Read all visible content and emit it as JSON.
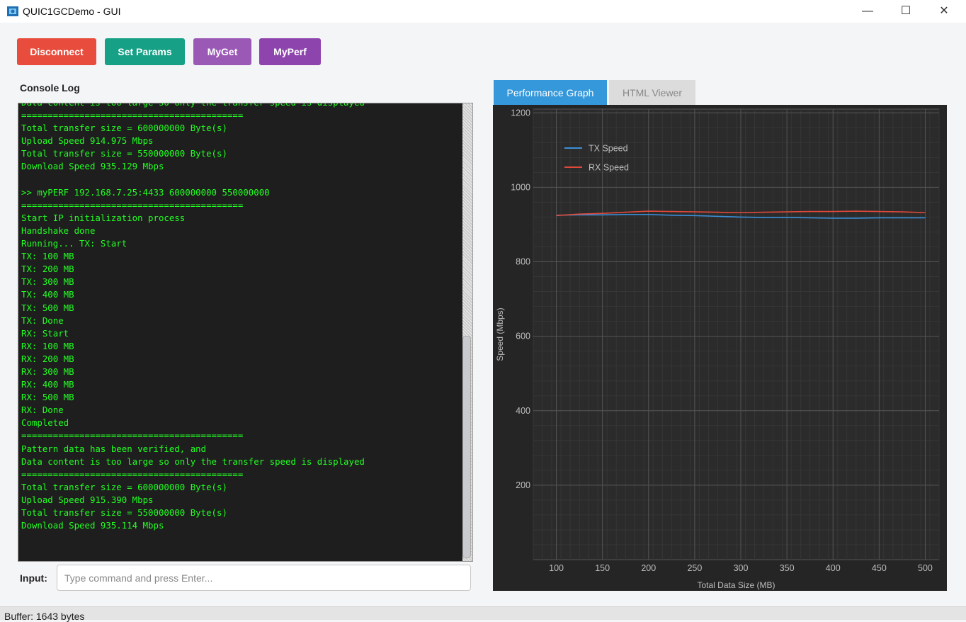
{
  "window": {
    "title": "QUIC1GCDemo - GUI",
    "minimize_glyph": "—",
    "maximize_glyph": "☐",
    "close_glyph": "✕"
  },
  "toolbar": {
    "disconnect_label": "Disconnect",
    "set_params_label": "Set Params",
    "myget_label": "MyGet",
    "myperf_label": "MyPerf",
    "colors": {
      "disconnect": "#e74c3c",
      "set_params": "#16a085",
      "myget": "#9b59b6",
      "myperf": "#8e44ad"
    }
  },
  "console": {
    "label": "Console Log",
    "text_color": "#22ff22",
    "lines": [
      "Data content is too large so only the transfer speed is displayed",
      "==========================================",
      "Total transfer size = 600000000 Byte(s)",
      "Upload Speed 914.975 Mbps",
      "Total transfer size = 550000000 Byte(s)",
      "Download Speed 935.129 Mbps",
      "",
      ">> myPERF 192.168.7.25:4433 600000000 550000000",
      "==========================================",
      "Start IP initialization process",
      "Handshake done",
      "Running... TX: Start",
      "TX: 100 MB",
      "TX: 200 MB",
      "TX: 300 MB",
      "TX: 400 MB",
      "TX: 500 MB",
      "TX: Done",
      "RX: Start",
      "RX: 100 MB",
      "RX: 200 MB",
      "RX: 300 MB",
      "RX: 400 MB",
      "RX: 500 MB",
      "RX: Done",
      "Completed",
      "==========================================",
      "Pattern data has been verified, and",
      "Data content is too large so only the transfer speed is displayed",
      "==========================================",
      "Total transfer size = 600000000 Byte(s)",
      "Upload Speed 915.390 Mbps",
      "Total transfer size = 550000000 Byte(s)",
      "Download Speed 935.114 Mbps",
      "",
      "",
      ">>"
    ]
  },
  "input": {
    "label": "Input:",
    "placeholder": "Type command and press Enter...",
    "value": ""
  },
  "tabs": [
    {
      "label": "Performance Graph",
      "active": true
    },
    {
      "label": "HTML Viewer",
      "active": false
    }
  ],
  "chart_data": {
    "type": "line",
    "xlabel": "Total Data Size (MB)",
    "ylabel": "Speed (Mbps)",
    "xlim": [
      75,
      515
    ],
    "ylim": [
      0,
      1210
    ],
    "xticks": [
      100,
      150,
      200,
      250,
      300,
      350,
      400,
      450,
      500
    ],
    "yticks": [
      200,
      400,
      600,
      800,
      1000,
      1200
    ],
    "grid": true,
    "legend_position": "top-left",
    "series": [
      {
        "name": "TX Speed",
        "color": "#3a8fd9",
        "x": [
          100,
          125,
          150,
          175,
          200,
          225,
          250,
          275,
          300,
          325,
          350,
          375,
          400,
          425,
          450,
          475,
          500
        ],
        "y": [
          925,
          926,
          926,
          927,
          927,
          925,
          924,
          922,
          920,
          919,
          919,
          918,
          917,
          917,
          918,
          918,
          918
        ]
      },
      {
        "name": "RX Speed",
        "color": "#e0493a",
        "x": [
          100,
          125,
          150,
          175,
          200,
          225,
          250,
          275,
          300,
          325,
          350,
          375,
          400,
          425,
          450,
          475,
          500
        ],
        "y": [
          924,
          928,
          930,
          933,
          936,
          935,
          934,
          933,
          932,
          933,
          934,
          935,
          935,
          936,
          935,
          934,
          932
        ]
      }
    ]
  },
  "status": {
    "buffer_text": "Buffer: 1643 bytes"
  }
}
